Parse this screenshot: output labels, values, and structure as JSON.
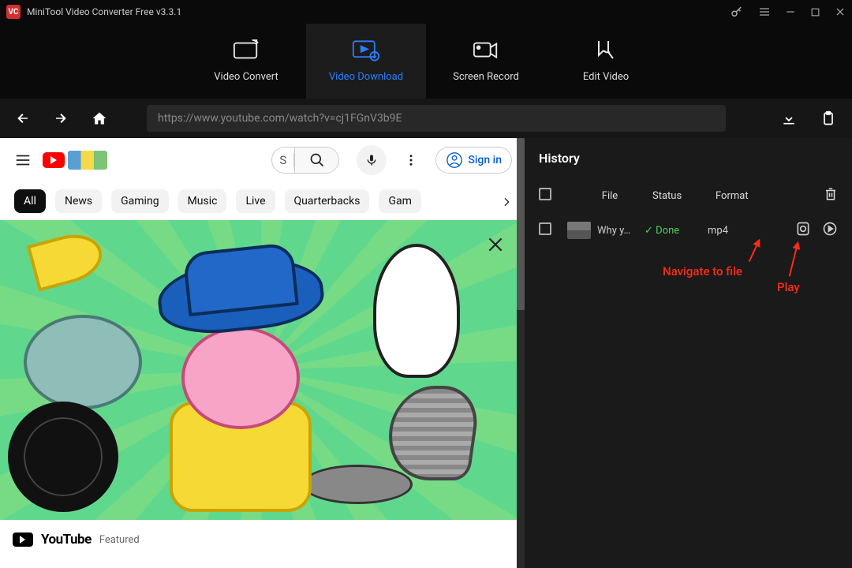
{
  "app": {
    "title": "MiniTool Video Converter Free v3.3.1"
  },
  "tabs": {
    "convert": "Video Convert",
    "download": "Video Download",
    "record": "Screen Record",
    "edit": "Edit Video"
  },
  "nav": {
    "url": "https://www.youtube.com/watch?v=cj1FGnV3b9E"
  },
  "youtube": {
    "search_letter": "S",
    "sign_in": "Sign in",
    "chips": [
      "All",
      "News",
      "Gaming",
      "Music",
      "Live",
      "Quarterbacks",
      "Gam"
    ],
    "brand": "YouTube",
    "featured": "Featured"
  },
  "history": {
    "title": "History",
    "columns": {
      "file": "File",
      "status": "Status",
      "format": "Format"
    },
    "rows": [
      {
        "file": "Why y…",
        "status": "Done",
        "format": "mp4"
      }
    ]
  },
  "annotations": {
    "navigate": "Navigate to file",
    "play": "Play"
  }
}
